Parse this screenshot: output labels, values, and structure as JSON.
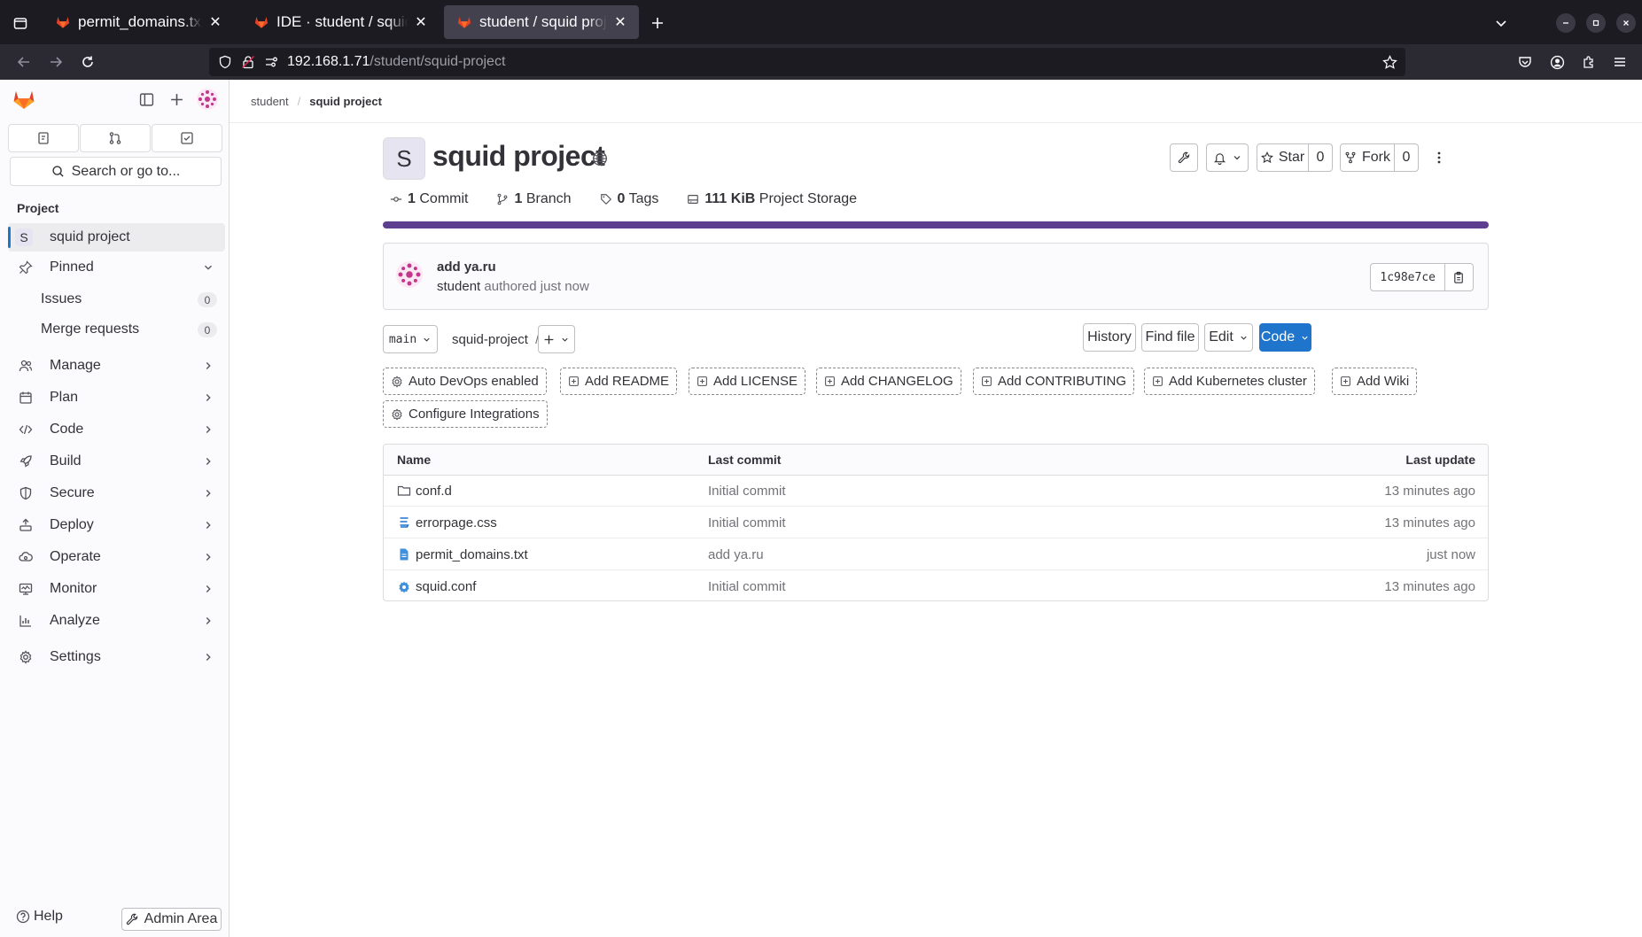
{
  "browser": {
    "tabs": [
      {
        "title": "permit_domains.txt · main · student / squid project · GitLab",
        "active": false
      },
      {
        "title": "IDE · student / squid project · GitLab",
        "active": false
      },
      {
        "title": "student / squid project · GitLab",
        "active": true
      }
    ],
    "url_host": "192.168.1.71",
    "url_path": "/student/squid-project"
  },
  "sidebar": {
    "search_label": "Search or go to...",
    "section_title": "Project",
    "project_item": {
      "avatar_letter": "S",
      "label": "squid project"
    },
    "pinned": {
      "label": "Pinned",
      "items": [
        {
          "label": "Issues",
          "count": "0"
        },
        {
          "label": "Merge requests",
          "count": "0"
        }
      ]
    },
    "menu": [
      {
        "label": "Manage",
        "icon": "users-icon"
      },
      {
        "label": "Plan",
        "icon": "calendar-icon"
      },
      {
        "label": "Code",
        "icon": "code-icon"
      },
      {
        "label": "Build",
        "icon": "rocket-icon"
      },
      {
        "label": "Secure",
        "icon": "shield-icon"
      },
      {
        "label": "Deploy",
        "icon": "deploy-icon"
      },
      {
        "label": "Operate",
        "icon": "cloud-gear-icon"
      },
      {
        "label": "Monitor",
        "icon": "monitor-icon"
      },
      {
        "label": "Analyze",
        "icon": "chart-icon"
      },
      {
        "label": "Settings",
        "icon": "gear-icon"
      }
    ],
    "help_label": "Help",
    "admin_label": "Admin Area"
  },
  "breadcrumb": {
    "parent": "student",
    "current": "squid project"
  },
  "project": {
    "avatar_letter": "S",
    "title": "squid project",
    "star_label": "Star",
    "star_count": "0",
    "fork_label": "Fork",
    "fork_count": "0",
    "stats": {
      "commits_num": "1",
      "commits_label": "Commit",
      "branches_num": "1",
      "branches_label": "Branch",
      "tags_num": "0",
      "tags_label": "Tags",
      "storage_num": "111 KiB",
      "storage_label": "Project Storage"
    }
  },
  "last_commit": {
    "title": "add ya.ru",
    "author": "student",
    "meta": "authored just now",
    "sha": "1c98e7ce"
  },
  "repo_toolbar": {
    "branch": "main",
    "path": "squid-project",
    "separator": "/",
    "history": "History",
    "find_file": "Find file",
    "edit": "Edit",
    "code": "Code"
  },
  "quick_actions": [
    "Auto DevOps enabled",
    "Add README",
    "Add LICENSE",
    "Add CHANGELOG",
    "Add CONTRIBUTING",
    "Add Kubernetes cluster",
    "Add Wiki",
    "Configure Integrations"
  ],
  "files": {
    "headers": {
      "name": "Name",
      "commit": "Last commit",
      "update": "Last update"
    },
    "rows": [
      {
        "name": "conf.d",
        "type": "folder",
        "commit": "Initial commit",
        "update": "13 minutes ago"
      },
      {
        "name": "errorpage.css",
        "type": "css",
        "commit": "Initial commit",
        "update": "13 minutes ago"
      },
      {
        "name": "permit_domains.txt",
        "type": "text",
        "commit": "add ya.ru",
        "update": "just now"
      },
      {
        "name": "squid.conf",
        "type": "config",
        "commit": "Initial commit",
        "update": "13 minutes ago"
      }
    ]
  },
  "colors": {
    "accent": "#1f75cb",
    "language_bar": "#5e3f8f",
    "gitlab_orange": "#e24329"
  }
}
